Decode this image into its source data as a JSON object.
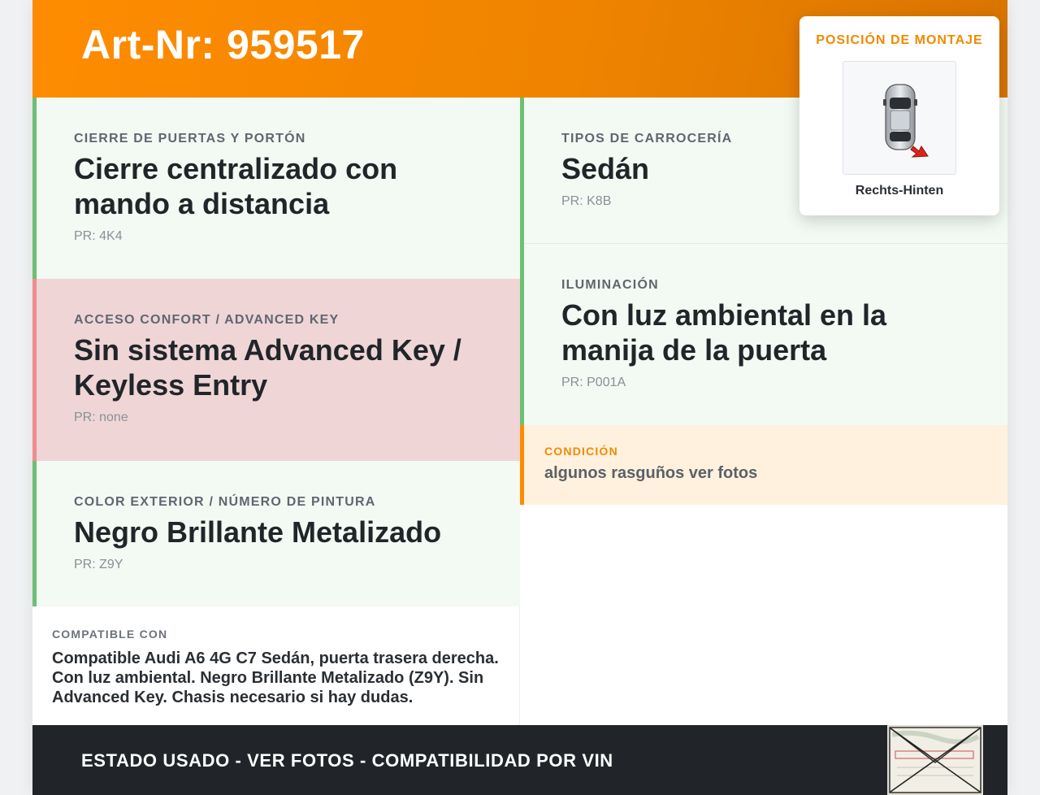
{
  "header": {
    "art_nr": "Art-Nr: 959517",
    "accent_color": "#ff8c00"
  },
  "cards": {
    "door_lock": {
      "label": "Cierre de puertas y portón",
      "value": "Cierre centralizado con mando a distancia",
      "pr": "PR: 4K4",
      "status": "ok"
    },
    "comfort_access": {
      "label": "Acceso confort / Advanced Key",
      "value": "Sin sistema Advanced Key / Keyless Entry",
      "pr": "PR: none",
      "status": "missing"
    },
    "exterior_color": {
      "label": "Color exterior / Número de pintura",
      "value": "Negro Brillante Metalizado",
      "pr": "PR: Z9Y",
      "status": "ok"
    },
    "body_type": {
      "label": "Tipos de carrocería",
      "value": "Sedán",
      "pr": "PR: K8B",
      "status": "ok"
    },
    "lighting": {
      "label": "Iluminación",
      "value": "Con luz ambiental en la manija de la puerta",
      "pr": "PR: P001A",
      "status": "ok"
    }
  },
  "compatible": {
    "label": "Compatible con",
    "text": "Compatible Audi A6 4G C7 Sedán, puerta trasera derecha. Con luz ambiental. Negro Brillante Metalizado (Z9Y). Sin Advanced Key. Chasis necesario si hay dudas."
  },
  "condition": {
    "label": "Condición",
    "text": "algunos rasguños ver fotos"
  },
  "mount_position": {
    "title": "POSICIÓN DE MONTAJE",
    "position": "Rechts-Hinten",
    "icon": "car-top-view-icon",
    "arrow_color": "#e0231a"
  },
  "footer": {
    "banner": "ESTADO USADO - VER FOTOS - COMPATIBILIDAD POR VIN",
    "thumbnail_icon": "vehicle-document-icon"
  },
  "status_colors": {
    "ok": "#6cc070",
    "missing": "#f08c8c",
    "ok_bg": "#f3f9f3",
    "missing_bg": "#efd5d6"
  }
}
